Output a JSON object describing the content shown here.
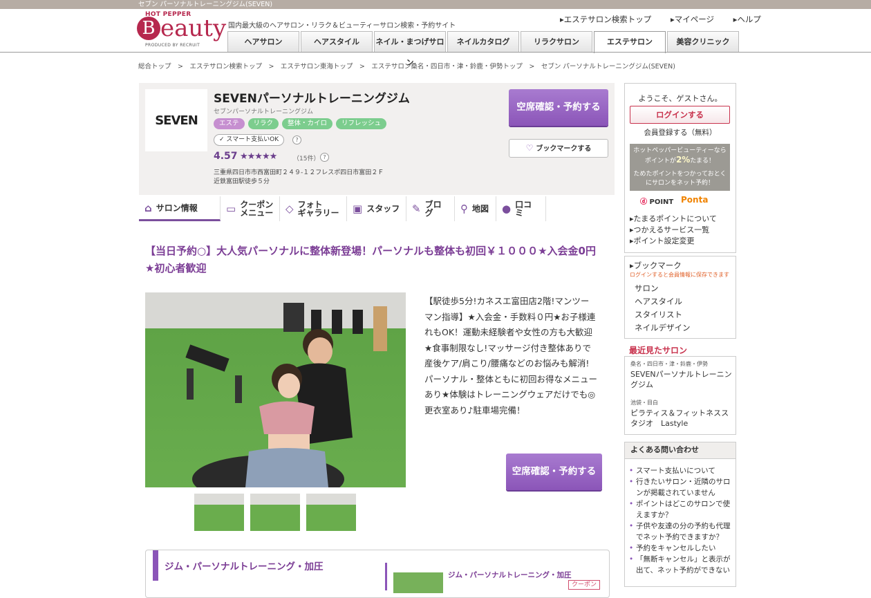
{
  "topbar": {
    "title": "セブン パーソナルトレーニングジム(SEVEN)"
  },
  "logo": {
    "hotpepper": "HOT PEPPER",
    "beauty_b": "B",
    "beauty": "eauty",
    "produced": "PRODUCED BY RECRUIT"
  },
  "header": {
    "tagline": "国内最大級のヘアサロン・リラク＆ビューティーサロン検索・予約サイト",
    "links": [
      "エステサロン検索トップ",
      "マイページ",
      "ヘルプ"
    ]
  },
  "nav": {
    "tabs": [
      "ヘアサロン",
      "ヘアスタイル",
      "ネイル・まつげサロン",
      "ネイルカタログ",
      "リラクサロン",
      "エステサロン",
      "美容クリニック"
    ],
    "active": "エステサロン"
  },
  "breadcrumb": "総合トップ　>　エステサロン検索トップ　>　エステサロン東海トップ　>　エステサロン桑名・四日市・津・鈴鹿・伊勢トップ　>　セブン パーソナルトレーニングジム(SEVEN)",
  "salon": {
    "logo_text": "SEVEN",
    "name": "SEVENパーソナルトレーニングジム",
    "kana": "セブンパーソナルトレーニングジム",
    "tags": [
      {
        "label": "エステ",
        "color": "#c68fd0"
      },
      {
        "label": "リラク",
        "color": "#7ccd8e"
      },
      {
        "label": "整体・カイロ",
        "color": "#7ccd8e"
      },
      {
        "label": "リフレッシュ",
        "color": "#7ccd8e"
      }
    ],
    "smart_pay": "スマート支払いOK",
    "help": "?",
    "rating": "4.57",
    "stars": "★★★★★",
    "review_count": "（15件）",
    "address": "三重県四日市市西富田町２４９-１２フレスポ四日市富田２Ｆ",
    "access": "近鉄富田駅徒歩５分",
    "reserve_label": "空席確認・予約する",
    "bookmark_label": "ブックマークする"
  },
  "salon_tabs": [
    {
      "label": "サロン情報",
      "icon": "home-icon"
    },
    {
      "label": "クーポン\nメニュー",
      "icon": "coupon-icon"
    },
    {
      "label": "フォト\nギャラリー",
      "icon": "photo-icon"
    },
    {
      "label": "スタッフ",
      "icon": "staff-icon"
    },
    {
      "label": "ブログ",
      "icon": "pen-icon"
    },
    {
      "label": "地図",
      "icon": "pin-icon"
    },
    {
      "label": "口コミ",
      "icon": "chat-icon"
    }
  ],
  "catch": "【当日予約○】大人気パーソナルに整体新登場！パーソナルも整体も初回￥１０００★入会金0円★初心者歓迎",
  "description": "【駅徒歩5分!カネスエ富田店2階!マンツーマン指導】★入会金・手数料０円★お子様連れもOK！運動未経験者や女性の方も大歓迎★食事制限なし!マッサージ付き整体ありで産後ケア/肩こり/腰痛などのお悩みも解消!パーソナル・整体ともに初回お得なメニューあり★体験はトレーニングウェアだけでも◎更衣室あり♪駐車場完備！",
  "menu": {
    "title": "ジム・パーソナルトレーニング・加圧",
    "sub_title": "ジム・パーソナルトレーニング・加圧",
    "coupon": "クーポン"
  },
  "sidebar": {
    "welcome": "ようこそ、ゲストさん。",
    "login": "ログインする",
    "register": "会員登録する（無料）",
    "point_line1": "ホットペッパービューティーなら",
    "point_line2a": "ポイントが",
    "point_pct": "2%",
    "point_line2b": "たまる！",
    "point_line3": "ためたポイントをつかっておとく",
    "point_line4": "にサロンをネット予約！",
    "dpoint": "POINT",
    "ponta": "Ponta",
    "links": [
      "たまるポイントについて",
      "つかえるサービス一覧",
      "ポイント設定変更"
    ],
    "bookmark_title": "ブックマーク",
    "bookmark_note": "ログインすると会員情報に保存できます",
    "bookmark_items": [
      "サロン",
      "ヘアスタイル",
      "スタイリスト",
      "ネイルデザイン"
    ],
    "recent_title": "最近見たサロン",
    "recent": [
      {
        "area": "桑名・四日市・津・鈴鹿・伊勢",
        "name": "SEVENパーソナルトレーニングジム"
      },
      {
        "area": "池袋・目白",
        "name": "ピラティス＆フィットネススタジオ　Lastyle"
      }
    ],
    "faq_title": "よくある問い合わせ",
    "faq": [
      "スマート支払いについて",
      "行きたいサロン・近隣のサロンが掲載されていません",
      "ポイントはどこのサロンで使えますか？",
      "子供や友達の分の予約も代理でネット予約できますか？",
      "予約をキャンセルしたい",
      "「無断キャンセル」と表示が出て、ネット予約ができない"
    ]
  }
}
